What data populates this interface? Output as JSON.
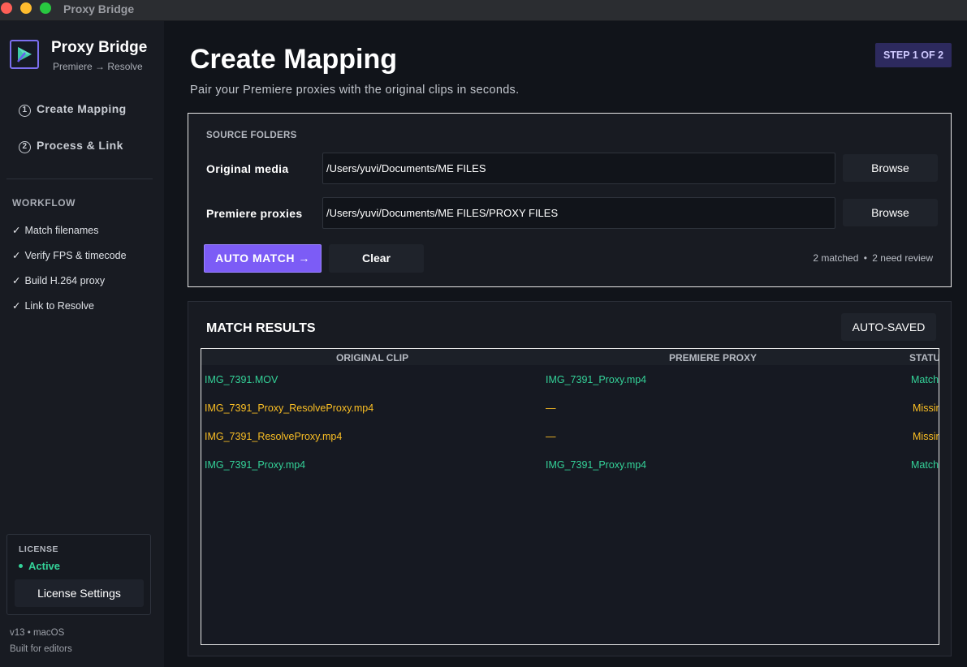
{
  "window": {
    "title": "Proxy Bridge"
  },
  "sidebar": {
    "brand_name": "Proxy Bridge",
    "brand_sub": "Premiere → Resolve",
    "nav": [
      {
        "num": "1",
        "label": "Create Mapping"
      },
      {
        "num": "2",
        "label": "Process & Link"
      }
    ],
    "workflow_heading": "WORKFLOW",
    "workflow": [
      {
        "check": "✓",
        "label": "Match filenames"
      },
      {
        "check": "✓",
        "label": "Verify FPS & timecode"
      },
      {
        "check": "✓",
        "label": "Build H.264 proxy"
      },
      {
        "check": "✓",
        "label": "Link to Resolve"
      }
    ],
    "license": {
      "label": "LICENSE",
      "status": "Active",
      "button": "License Settings"
    },
    "version": "v13 • macOS",
    "built_for": "Built for editors"
  },
  "main": {
    "title": "Create Mapping",
    "subtitle": "Pair your Premiere proxies with the original clips in seconds.",
    "step_badge": "STEP 1 OF 2",
    "source": {
      "heading": "SOURCE FOLDERS",
      "original_label": "Original media",
      "original_value": "/Users/yuvi/Documents/ME FILES",
      "proxies_label": "Premiere proxies",
      "proxies_value": "/Users/yuvi/Documents/ME FILES/PROXY FILES",
      "browse_label": "Browse",
      "auto_match": "AUTO MATCH →",
      "clear": "Clear",
      "matched": "2 matched",
      "separator": "•",
      "review": "2 need review"
    },
    "results": {
      "heading": "MATCH RESULTS",
      "saved": "AUTO-SAVED",
      "columns": [
        "ORIGINAL CLIP",
        "PREMIERE PROXY",
        "STATU"
      ],
      "rows": [
        {
          "original": "IMG_7391.MOV",
          "proxy": "IMG_7391_Proxy.mp4",
          "status": "Matche",
          "kind": "ok"
        },
        {
          "original": "IMG_7391_Proxy_ResolveProxy.mp4",
          "proxy": "—",
          "status": "Missin",
          "kind": "warn"
        },
        {
          "original": "IMG_7391_ResolveProxy.mp4",
          "proxy": "—",
          "status": "Missin",
          "kind": "warn"
        },
        {
          "original": "IMG_7391_Proxy.mp4",
          "proxy": "IMG_7391_Proxy.mp4",
          "status": "Matche",
          "kind": "ok"
        }
      ]
    }
  }
}
